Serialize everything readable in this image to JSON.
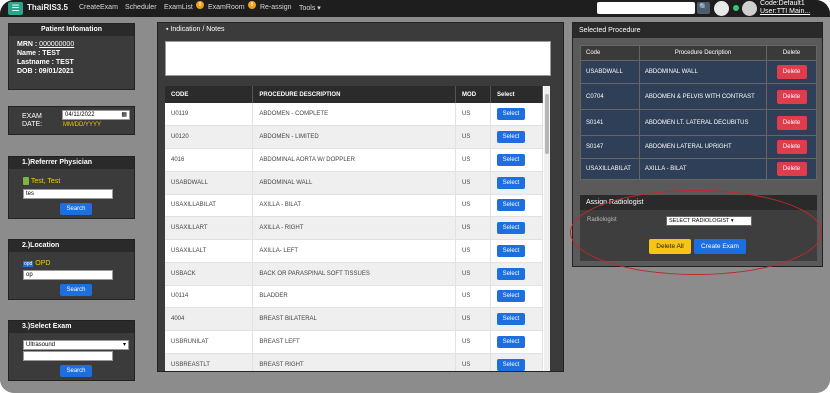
{
  "nav": {
    "menu_icon": "☰",
    "brand": "ThaiRIS3.5",
    "links": [
      "CreateExam",
      "Scheduler",
      "ExamList",
      "ExamRoom",
      "Re-assign",
      "Tools ▾"
    ],
    "badges": [
      "8",
      "8"
    ],
    "search_icon": "🔍",
    "user_code": "Code:Default1",
    "user_name": "User:TTI Main..."
  },
  "patient": {
    "title": "Patient Infomation",
    "mrn_label": "MRN : ",
    "mrn": "000000000",
    "name_label": "Name : ",
    "name": "TEST",
    "lastname_label": "Lastname : ",
    "lastname": "TEST",
    "dob_label": "DOB : ",
    "dob": "09/01/2021"
  },
  "exam_date": {
    "label1": "EXAM",
    "label2": "DATE:",
    "value": "04/11/2022",
    "hint": "MM/DD/YYYY"
  },
  "referrer": {
    "title": "1.)Referrer Physician",
    "selected": "Test, Test",
    "input": "tes",
    "button": "Search"
  },
  "location": {
    "title": "2.)Location",
    "tag": "opd",
    "selected": "OPD",
    "input": "op",
    "button": "Search"
  },
  "select_exam": {
    "title": "3.)Select Exam",
    "modality": "Ultrasound",
    "input": "",
    "button": "Search"
  },
  "indication": {
    "title": "Indication / Notes"
  },
  "procedures": {
    "headers": [
      "CODE",
      "PROCEDURE DESCRIPTION",
      "MOD",
      "Select"
    ],
    "rows": [
      {
        "code": "U0119",
        "desc": "ABDOMEN - COMPLETE",
        "mod": "US",
        "btn": "Select"
      },
      {
        "code": "U0120",
        "desc": "ABDOMEN - LIMITED",
        "mod": "US",
        "btn": "Select"
      },
      {
        "code": "4016",
        "desc": "ABDOMINAL AORTA W/ DOPPLER",
        "mod": "US",
        "btn": "Select"
      },
      {
        "code": "USABDWALL",
        "desc": "ABDOMINAL WALL",
        "mod": "US",
        "btn": "Select"
      },
      {
        "code": "USAXILLABILAT",
        "desc": "AXILLA - BILAT",
        "mod": "US",
        "btn": "Select"
      },
      {
        "code": "USAXILLART",
        "desc": "AXILLA - RIGHT",
        "mod": "US",
        "btn": "Select"
      },
      {
        "code": "USAXILLALT",
        "desc": "AXILLA- LEFT",
        "mod": "US",
        "btn": "Select"
      },
      {
        "code": "USBACK",
        "desc": "BACK OR PARASPINAL SOFT TISSUES",
        "mod": "US",
        "btn": "Select"
      },
      {
        "code": "U0114",
        "desc": "BLADDER",
        "mod": "US",
        "btn": "Select"
      },
      {
        "code": "4004",
        "desc": "BREAST BILATERAL",
        "mod": "US",
        "btn": "Select"
      },
      {
        "code": "USBRUNILAT",
        "desc": "BREAST LEFT",
        "mod": "US",
        "btn": "Select"
      },
      {
        "code": "USBREASTLT",
        "desc": "BREAST RIGHT",
        "mod": "US",
        "btn": "Select"
      }
    ]
  },
  "selected": {
    "title": "Selected Procedure",
    "headers": [
      "Code",
      "Procedure Decription",
      "Delete"
    ],
    "rows": [
      {
        "code": "USABDWALL",
        "desc": "ABDOMINAL WALL",
        "btn": "Delete"
      },
      {
        "code": "C0704",
        "desc": "ABDOMEN & PELVIS WITH CONTRAST",
        "btn": "Delete"
      },
      {
        "code": "S0141",
        "desc": "ABDOMEN LT. LATERAL DECUBITUS",
        "btn": "Delete"
      },
      {
        "code": "S0147",
        "desc": "ABDOMEN LATERAL UPRIGHT",
        "btn": "Delete"
      },
      {
        "code": "USAXILLABILAT",
        "desc": "AXILLA - BILAT",
        "btn": "Delete"
      }
    ]
  },
  "assign": {
    "title": "Assign Radiologist",
    "label": "Radiologist",
    "select": "SELECT RADIOLOGIST ▾",
    "delete_all": "Delete All",
    "create_exam": "Create Exam"
  }
}
